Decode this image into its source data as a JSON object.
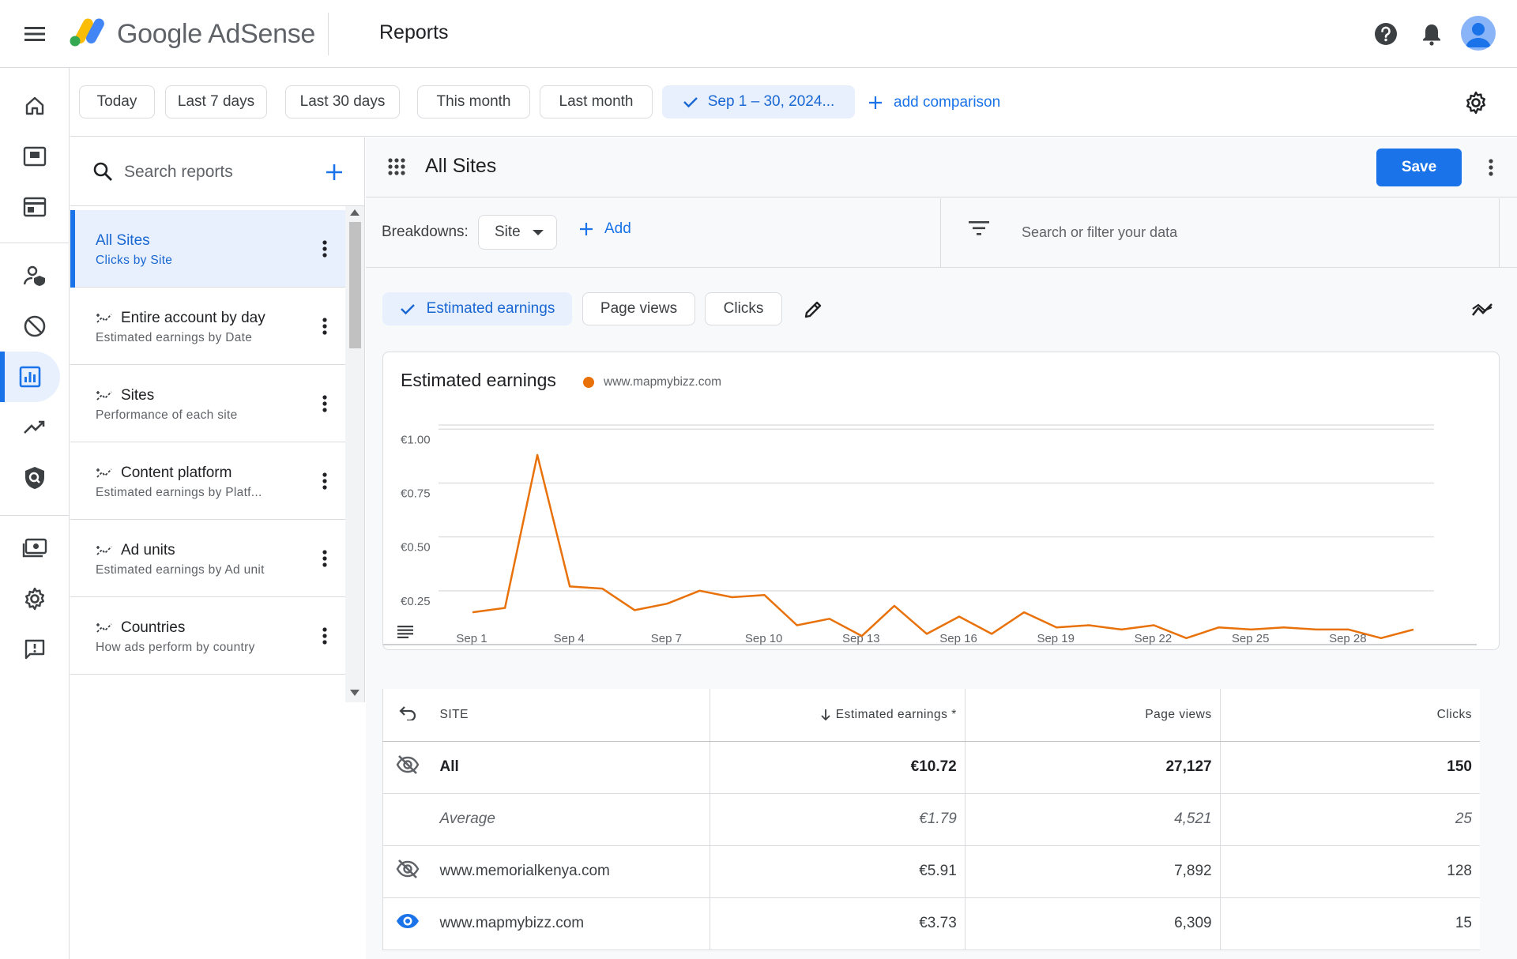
{
  "app": {
    "brand": "Google AdSense",
    "page_title": "Reports"
  },
  "date_range": {
    "presets": [
      "Today",
      "Last 7 days",
      "Last 30 days",
      "This month",
      "Last month"
    ],
    "selected": "Sep 1 – 30, 2024...",
    "add_comparison": "add comparison"
  },
  "reports_panel": {
    "search_placeholder": "Search reports",
    "items": [
      {
        "title": "All Sites",
        "subtitle": "Clicks by Site"
      },
      {
        "title": "Entire account by day",
        "subtitle": "Estimated earnings by Date"
      },
      {
        "title": "Sites",
        "subtitle": "Performance of each site"
      },
      {
        "title": "Content platform",
        "subtitle": "Estimated earnings by Platf..."
      },
      {
        "title": "Ad units",
        "subtitle": "Estimated earnings by Ad unit"
      },
      {
        "title": "Countries",
        "subtitle": "How ads perform by country"
      }
    ]
  },
  "report": {
    "title": "All Sites",
    "save_label": "Save",
    "breakdowns_label": "Breakdowns:",
    "breakdown_value": "Site",
    "add_label": "Add",
    "filter_placeholder": "Search or filter your data",
    "metrics": [
      "Estimated earnings",
      "Page views",
      "Clicks"
    ]
  },
  "chart_data": {
    "type": "line",
    "title": "Estimated earnings",
    "legend_placement": "top-left",
    "series": [
      {
        "name": "www.mapmybizz.com",
        "color": "#e8710a",
        "values": [
          0.15,
          0.17,
          0.88,
          0.27,
          0.26,
          0.16,
          0.19,
          0.25,
          0.22,
          0.23,
          0.09,
          0.12,
          0.04,
          0.18,
          0.05,
          0.13,
          0.05,
          0.15,
          0.08,
          0.09,
          0.07,
          0.09,
          0.03,
          0.08,
          0.07,
          0.08,
          0.07,
          0.07,
          0.03,
          0.07
        ]
      }
    ],
    "x": [
      "Sep 1",
      "Sep 2",
      "Sep 3",
      "Sep 4",
      "Sep 5",
      "Sep 6",
      "Sep 7",
      "Sep 8",
      "Sep 9",
      "Sep 10",
      "Sep 11",
      "Sep 12",
      "Sep 13",
      "Sep 14",
      "Sep 15",
      "Sep 16",
      "Sep 17",
      "Sep 18",
      "Sep 19",
      "Sep 20",
      "Sep 21",
      "Sep 22",
      "Sep 23",
      "Sep 24",
      "Sep 25",
      "Sep 26",
      "Sep 27",
      "Sep 28",
      "Sep 29",
      "Sep 30"
    ],
    "x_tick_labels": [
      "Sep 1",
      "Sep 4",
      "Sep 7",
      "Sep 10",
      "Sep 13",
      "Sep 16",
      "Sep 19",
      "Sep 22",
      "Sep 25",
      "Sep 28"
    ],
    "y_tick_labels": [
      "€0.25",
      "€0.50",
      "€0.75",
      "€1.00"
    ],
    "y_ticks": [
      0.25,
      0.5,
      0.75,
      1.0
    ],
    "ylim": [
      0,
      1.1
    ],
    "grid": true
  },
  "table": {
    "columns": {
      "site": "SITE",
      "earnings": "Estimated earnings *",
      "page_views": "Page views",
      "clicks": "Clicks"
    },
    "total": {
      "label": "All",
      "earnings": "€10.72",
      "page_views": "27,127",
      "clicks": "150"
    },
    "average": {
      "label": "Average",
      "earnings": "€1.79",
      "page_views": "4,521",
      "clicks": "25"
    },
    "rows": [
      {
        "site": "www.memorialkenya.com",
        "earnings": "€5.91",
        "page_views": "7,892",
        "clicks": "128",
        "visible": false
      },
      {
        "site": "www.mapmybizz.com",
        "earnings": "€3.73",
        "page_views": "6,309",
        "clicks": "15",
        "visible": true
      }
    ]
  },
  "colors": {
    "accent": "#1a73e8",
    "series": "#e8710a",
    "selected_bg": "#e8f0fe"
  }
}
